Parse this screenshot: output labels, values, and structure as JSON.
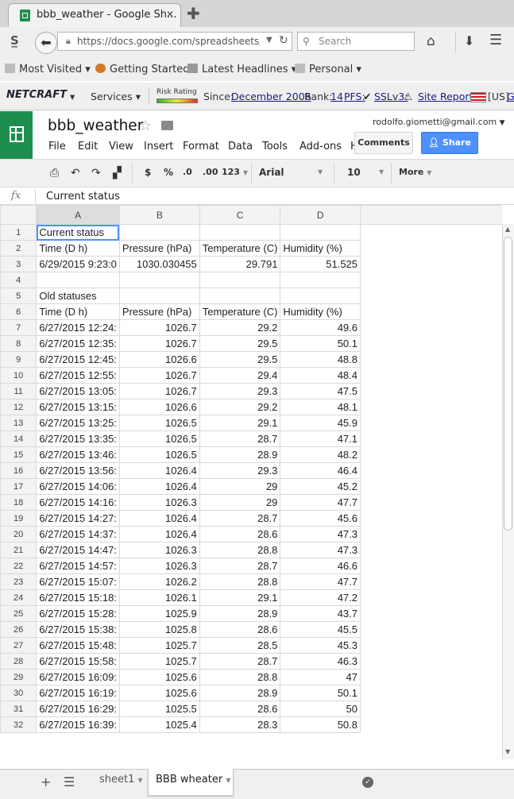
{
  "browser": {
    "tab_title": "bbb_weather - Google Sh...",
    "url": "https://docs.google.com/spreadsheets/d/1",
    "search_placeholder": "Search"
  },
  "bookmarks": [
    "Most Visited",
    "Getting Started",
    "Latest Headlines",
    "Personal"
  ],
  "netcraft": {
    "logo": "NETCRAFT",
    "services": "Services",
    "risk_rating": "Risk Rating",
    "since_label": "Since:",
    "since_value": "December 2006",
    "rank_label": "Rank:",
    "rank_value": "14",
    "pfs": "PFS:",
    "sslv3": "SSLv3:",
    "site_report": "Site Report",
    "country": "[US]",
    "extra": "G"
  },
  "sheets": {
    "doc_title": "bbb_weather",
    "user_email": "rodolfo.giometti@gmail.com",
    "menu": [
      "File",
      "Edit",
      "View",
      "Insert",
      "Format",
      "Data",
      "Tools",
      "Add-ons",
      "H"
    ],
    "comments": "Comments",
    "share": "Share"
  },
  "toolbar": {
    "currency": "$",
    "percent": "%",
    "dec_less": ".0",
    "dec_more": ".00",
    "format": "123",
    "font": "Arial",
    "font_size": "10",
    "more": "More"
  },
  "formula_bar": {
    "fx": "fx",
    "value": "Current status"
  },
  "grid": {
    "columns": [
      "A",
      "B",
      "C",
      "D"
    ],
    "rows": [
      [
        "1",
        "Current status",
        "",
        "",
        ""
      ],
      [
        "2",
        "Time (D h)",
        "Pressure (hPa)",
        "Temperature (C)",
        "Humidity (%)"
      ],
      [
        "3",
        "6/29/2015 9:23:0",
        "1030.030455",
        "29.791",
        "51.525"
      ],
      [
        "4",
        "",
        "",
        "",
        ""
      ],
      [
        "5",
        "Old statuses",
        "",
        "",
        ""
      ],
      [
        "6",
        "Time (D h)",
        "Pressure (hPa)",
        "Temperature (C)",
        "Humidity (%)"
      ],
      [
        "7",
        "6/27/2015 12:24:",
        "1026.7",
        "29.2",
        "49.6"
      ],
      [
        "8",
        "6/27/2015 12:35:",
        "1026.7",
        "29.5",
        "50.1"
      ],
      [
        "9",
        "6/27/2015 12:45:",
        "1026.6",
        "29.5",
        "48.8"
      ],
      [
        "10",
        "6/27/2015 12:55:",
        "1026.7",
        "29.4",
        "48.4"
      ],
      [
        "11",
        "6/27/2015 13:05:",
        "1026.7",
        "29.3",
        "47.5"
      ],
      [
        "12",
        "6/27/2015 13:15:",
        "1026.6",
        "29.2",
        "48.1"
      ],
      [
        "13",
        "6/27/2015 13:25:",
        "1026.5",
        "29.1",
        "45.9"
      ],
      [
        "14",
        "6/27/2015 13:35:",
        "1026.5",
        "28.7",
        "47.1"
      ],
      [
        "15",
        "6/27/2015 13:46:",
        "1026.5",
        "28.9",
        "48.2"
      ],
      [
        "16",
        "6/27/2015 13:56:",
        "1026.4",
        "29.3",
        "46.4"
      ],
      [
        "17",
        "6/27/2015 14:06:",
        "1026.4",
        "29",
        "45.2"
      ],
      [
        "18",
        "6/27/2015 14:16:",
        "1026.3",
        "29",
        "47.7"
      ],
      [
        "19",
        "6/27/2015 14:27:",
        "1026.4",
        "28.7",
        "45.6"
      ],
      [
        "20",
        "6/27/2015 14:37:",
        "1026.4",
        "28.6",
        "47.3"
      ],
      [
        "21",
        "6/27/2015 14:47:",
        "1026.3",
        "28.8",
        "47.3"
      ],
      [
        "22",
        "6/27/2015 14:57:",
        "1026.3",
        "28.7",
        "46.6"
      ],
      [
        "23",
        "6/27/2015 15:07:",
        "1026.2",
        "28.8",
        "47.7"
      ],
      [
        "24",
        "6/27/2015 15:18:",
        "1026.1",
        "29.1",
        "47.2"
      ],
      [
        "25",
        "6/27/2015 15:28:",
        "1025.9",
        "28.9",
        "43.7"
      ],
      [
        "26",
        "6/27/2015 15:38:",
        "1025.8",
        "28.6",
        "45.5"
      ],
      [
        "27",
        "6/27/2015 15:48:",
        "1025.7",
        "28.5",
        "45.3"
      ],
      [
        "28",
        "6/27/2015 15:58:",
        "1025.7",
        "28.7",
        "46.3"
      ],
      [
        "29",
        "6/27/2015 16:09:",
        "1025.6",
        "28.8",
        "47"
      ],
      [
        "30",
        "6/27/2015 16:19:",
        "1025.6",
        "28.9",
        "50.1"
      ],
      [
        "31",
        "6/27/2015 16:29:",
        "1025.5",
        "28.6",
        "50"
      ],
      [
        "32",
        "6/27/2015 16:39:",
        "1025.4",
        "28.3",
        "50.8"
      ]
    ]
  },
  "sheet_tabs": [
    "sheet1",
    "BBB wheater"
  ],
  "colors": {
    "sheets_green": "#1e8e4f",
    "share_blue": "#4d90fe",
    "selection_blue": "#4d90fe"
  }
}
